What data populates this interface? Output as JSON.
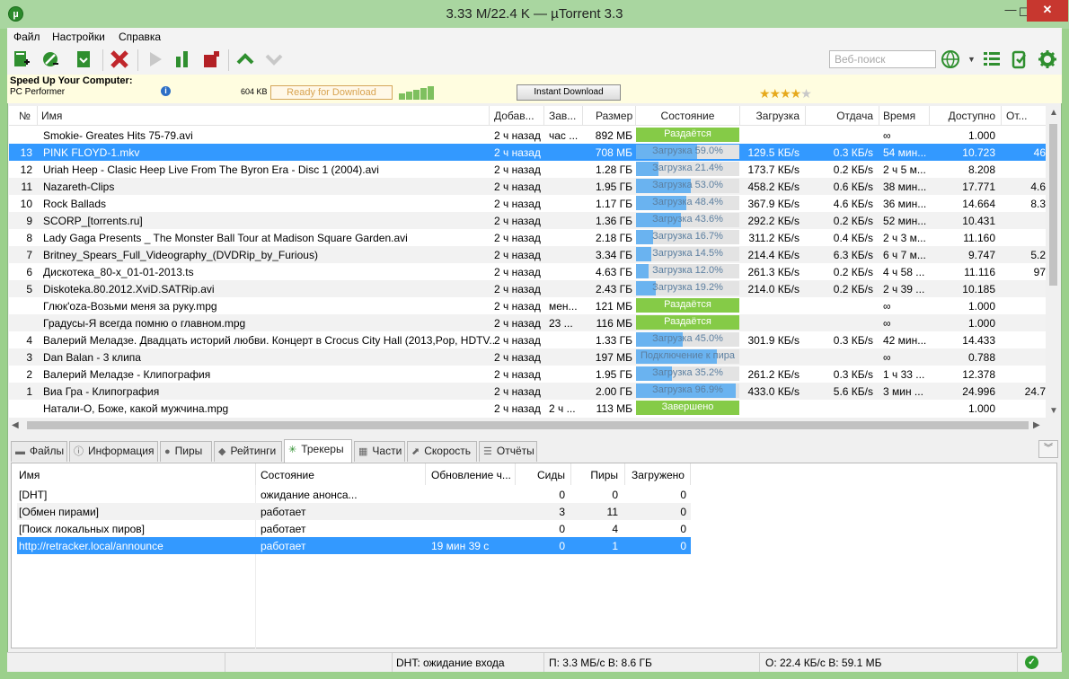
{
  "window": {
    "title": "3.33 M/22.4 K — µTorrent 3.3",
    "logo": "µ"
  },
  "menu": {
    "file": "Файл",
    "settings": "Настройки",
    "help": "Справка"
  },
  "toolbar": {
    "search_placeholder": "Веб-поиск",
    "icons": [
      "add-torrent-icon",
      "add-url-icon",
      "create-torrent-icon",
      "remove-icon",
      "start-icon",
      "pause-icon",
      "stop-icon",
      "move-up-icon",
      "move-down-icon",
      "globe-icon",
      "list-view-icon",
      "remote-icon",
      "settings-icon"
    ]
  },
  "ad": {
    "title": "Speed Up Your Computer:",
    "subtitle": "PC Performer",
    "size": "604 KB",
    "ready": "Ready for Download",
    "button": "Instant Download",
    "rating": 4,
    "rating_max": 5
  },
  "torrents": {
    "columns": {
      "num": "№",
      "name": "Имя",
      "added": "Добав...",
      "completed": "Зав...",
      "size": "Размер",
      "status": "Состояние",
      "down": "Загрузка",
      "up": "Отдача",
      "eta": "Время",
      "avail": "Доступно",
      "ratio": "От..."
    },
    "rows": [
      {
        "num": "",
        "name": "Smokie- Greates Hits 75-79.avi",
        "added": "2 ч назад",
        "completed": "час ...",
        "size": "892 МБ",
        "status": "Раздаётся",
        "progress": 100,
        "kind": "seed",
        "down": "",
        "up": "",
        "eta": "∞",
        "avail": "1.000",
        "ratio": ""
      },
      {
        "num": "13",
        "name": "PINK FLOYD-1.mkv",
        "added": "2 ч назад",
        "completed": "",
        "size": "708 МБ",
        "status": "Загрузка 59.0%",
        "progress": 59,
        "kind": "dl",
        "down": "129.5 КБ/s",
        "up": "0.3 КБ/s",
        "eta": "54 мин...",
        "avail": "10.723",
        "ratio": "46",
        "selected": true
      },
      {
        "num": "12",
        "name": "Uriah Heep - Clasic Heep Live From The Byron Era - Disc 1 (2004).avi",
        "added": "2 ч назад",
        "completed": "",
        "size": "1.28 ГБ",
        "status": "Загрузка 21.4%",
        "progress": 21.4,
        "kind": "dl",
        "down": "173.7 КБ/s",
        "up": "0.2 КБ/s",
        "eta": "2 ч 5 м...",
        "avail": "8.208",
        "ratio": ""
      },
      {
        "num": "11",
        "name": "Nazareth-Clips",
        "added": "2 ч назад",
        "completed": "",
        "size": "1.95 ГБ",
        "status": "Загрузка 53.0%",
        "progress": 53,
        "kind": "dl",
        "down": "458.2 КБ/s",
        "up": "0.6 КБ/s",
        "eta": "38 мин...",
        "avail": "17.771",
        "ratio": "4.6"
      },
      {
        "num": "10",
        "name": "Rock Ballads",
        "added": "2 ч назад",
        "completed": "",
        "size": "1.17 ГБ",
        "status": "Загрузка 48.4%",
        "progress": 48.4,
        "kind": "dl",
        "down": "367.9 КБ/s",
        "up": "4.6 КБ/s",
        "eta": "36 мин...",
        "avail": "14.664",
        "ratio": "8.3"
      },
      {
        "num": "9",
        "name": "SCORP_[torrents.ru]",
        "added": "2 ч назад",
        "completed": "",
        "size": "1.36 ГБ",
        "status": "Загрузка 43.6%",
        "progress": 43.6,
        "kind": "dl",
        "down": "292.2 КБ/s",
        "up": "0.2 КБ/s",
        "eta": "52 мин...",
        "avail": "10.431",
        "ratio": ""
      },
      {
        "num": "8",
        "name": "Lady Gaga Presents _ The Monster Ball Tour at Madison Square Garden.avi",
        "added": "2 ч назад",
        "completed": "",
        "size": "2.18 ГБ",
        "status": "Загрузка 16.7%",
        "progress": 16.7,
        "kind": "dl",
        "down": "311.2 КБ/s",
        "up": "0.4 КБ/s",
        "eta": "2 ч 3 м...",
        "avail": "11.160",
        "ratio": ""
      },
      {
        "num": "7",
        "name": "Britney_Spears_Full_Videography_(DVDRip_by_Furious)",
        "added": "2 ч назад",
        "completed": "",
        "size": "3.34 ГБ",
        "status": "Загрузка 14.5%",
        "progress": 14.5,
        "kind": "dl",
        "down": "214.4 КБ/s",
        "up": "6.3 КБ/s",
        "eta": "6 ч 7 м...",
        "avail": "9.747",
        "ratio": "5.2"
      },
      {
        "num": "6",
        "name": "Дискотека_80-х_01-01-2013.ts",
        "added": "2 ч назад",
        "completed": "",
        "size": "4.63 ГБ",
        "status": "Загрузка 12.0%",
        "progress": 12,
        "kind": "dl",
        "down": "261.3 КБ/s",
        "up": "0.2 КБ/s",
        "eta": "4 ч 58 ...",
        "avail": "11.116",
        "ratio": "97"
      },
      {
        "num": "5",
        "name": "Diskoteka.80.2012.XviD.SATRip.avi",
        "added": "2 ч назад",
        "completed": "",
        "size": "2.43 ГБ",
        "status": "Загрузка 19.2%",
        "progress": 19.2,
        "kind": "dl",
        "down": "214.0 КБ/s",
        "up": "0.2 КБ/s",
        "eta": "2 ч 39 ...",
        "avail": "10.185",
        "ratio": ""
      },
      {
        "num": "",
        "name": "Глюк'oza-Возьми меня за руку.mpg",
        "added": "2 ч назад",
        "completed": "мен...",
        "size": "121 МБ",
        "status": "Раздаётся",
        "progress": 100,
        "kind": "seed",
        "down": "",
        "up": "",
        "eta": "∞",
        "avail": "1.000",
        "ratio": ""
      },
      {
        "num": "",
        "name": "Градусы-Я всегда помню о главном.mpg",
        "added": "2 ч назад",
        "completed": "23 ...",
        "size": "116 МБ",
        "status": "Раздаётся",
        "progress": 100,
        "kind": "seed",
        "down": "",
        "up": "",
        "eta": "∞",
        "avail": "1.000",
        "ratio": ""
      },
      {
        "num": "4",
        "name": "Валерий Меладзе. Двадцать историй любви. Концерт в Crocus City Hall (2013,Pop, HDTV...",
        "added": "2 ч назад",
        "completed": "",
        "size": "1.33 ГБ",
        "status": "Загрузка 45.0%",
        "progress": 45,
        "kind": "dl",
        "down": "301.9 КБ/s",
        "up": "0.3 КБ/s",
        "eta": "42 мин...",
        "avail": "14.433",
        "ratio": ""
      },
      {
        "num": "3",
        "name": "Dan Balan - 3 клипа",
        "added": "2 ч назад",
        "completed": "",
        "size": "197 МБ",
        "status": "Подключение к пира",
        "progress": 78,
        "kind": "dl",
        "down": "",
        "up": "",
        "eta": "∞",
        "avail": "0.788",
        "ratio": ""
      },
      {
        "num": "2",
        "name": "Валерий Меладзе - Клипография",
        "added": "2 ч назад",
        "completed": "",
        "size": "1.95 ГБ",
        "status": "Загрузка 35.2%",
        "progress": 35.2,
        "kind": "dl",
        "down": "261.2 КБ/s",
        "up": "0.3 КБ/s",
        "eta": "1 ч 33 ...",
        "avail": "12.378",
        "ratio": ""
      },
      {
        "num": "1",
        "name": "Виа Гра - Клипография",
        "added": "2 ч назад",
        "completed": "",
        "size": "2.00 ГБ",
        "status": "Загрузка 96.9%",
        "progress": 96.9,
        "kind": "dl",
        "down": "433.0 КБ/s",
        "up": "5.6 КБ/s",
        "eta": "3 мин ...",
        "avail": "24.996",
        "ratio": "24.7"
      },
      {
        "num": "",
        "name": "Натали-О, Боже, какой мужчина.mpg",
        "added": "2 ч назад",
        "completed": "2 ч ...",
        "size": "113 МБ",
        "status": "Завершено",
        "progress": 100,
        "kind": "done",
        "down": "",
        "up": "",
        "eta": "",
        "avail": "1.000",
        "ratio": ""
      }
    ]
  },
  "tabs": [
    {
      "label": "Файлы",
      "icon": "folder-icon"
    },
    {
      "label": "Информация",
      "icon": "info-icon"
    },
    {
      "label": "Пиры",
      "icon": "peers-icon"
    },
    {
      "label": "Рейтинги",
      "icon": "ratings-icon"
    },
    {
      "label": "Трекеры",
      "icon": "trackers-icon",
      "active": true
    },
    {
      "label": "Части",
      "icon": "pieces-icon"
    },
    {
      "label": "Скорость",
      "icon": "speed-icon"
    },
    {
      "label": "Отчёты",
      "icon": "logger-icon"
    }
  ],
  "trackers": {
    "columns": {
      "name": "Имя",
      "status": "Состояние",
      "update": "Обновление ч...",
      "seeds": "Сиды",
      "peers": "Пиры",
      "downloaded": "Загружено"
    },
    "rows": [
      {
        "name": "[DHT]",
        "status": "ожидание анонса...",
        "update": "",
        "seeds": "0",
        "peers": "0",
        "downloaded": "0"
      },
      {
        "name": "[Обмен пирами]",
        "status": "работает",
        "update": "",
        "seeds": "3",
        "peers": "11",
        "downloaded": "0"
      },
      {
        "name": "[Поиск локальных пиров]",
        "status": "работает",
        "update": "",
        "seeds": "0",
        "peers": "4",
        "downloaded": "0"
      },
      {
        "name": "http://retracker.local/announce",
        "status": "работает",
        "update": "19 мин 39 с",
        "seeds": "0",
        "peers": "1",
        "downloaded": "0",
        "selected": true
      }
    ]
  },
  "statusbar": {
    "dht": "DHT: ожидание входа",
    "down": "П: 3.3 МБ/с В: 8.6 ГБ",
    "up": "О: 22.4 КБ/с В: 59.1 МБ"
  }
}
